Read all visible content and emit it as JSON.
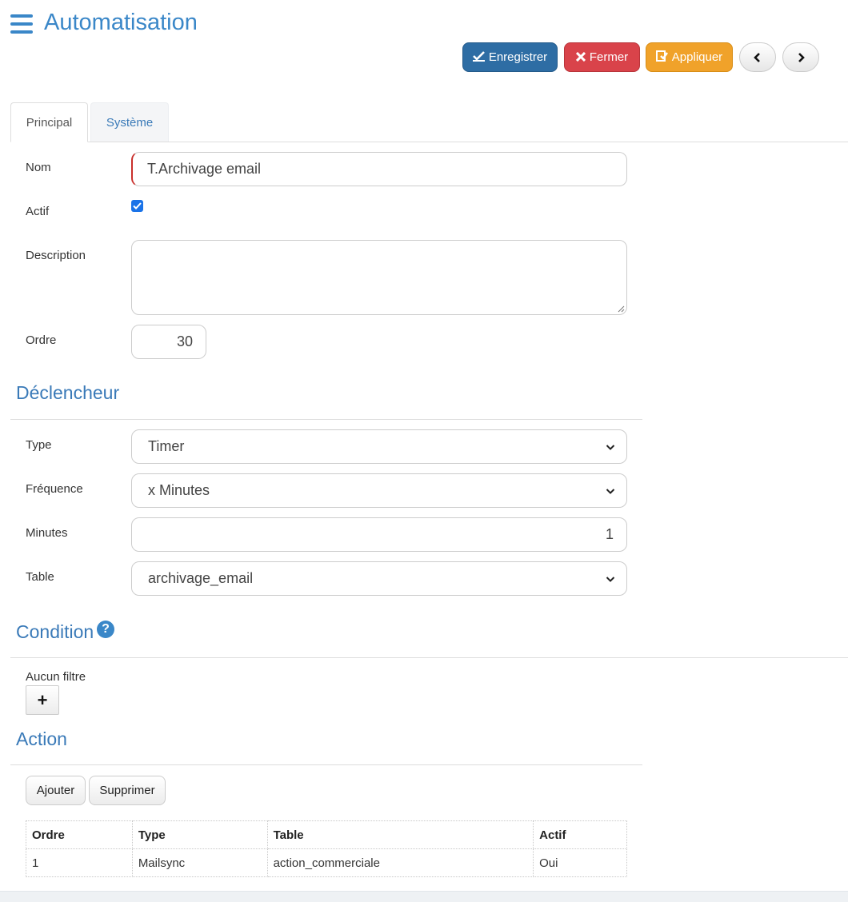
{
  "header": {
    "title": "Automatisation"
  },
  "toolbar": {
    "save_label": "Enregistrer",
    "close_label": "Fermer",
    "apply_label": "Appliquer",
    "prev_icon": "chevron-left-icon",
    "next_icon": "chevron-right-icon"
  },
  "tabs": [
    {
      "label": "Principal",
      "active": true
    },
    {
      "label": "Système",
      "active": false
    }
  ],
  "form": {
    "nom_label": "Nom",
    "nom_value": "T.Archivage email",
    "actif_label": "Actif",
    "actif_checked": true,
    "description_label": "Description",
    "description_value": "",
    "ordre_label": "Ordre",
    "ordre_value": "30"
  },
  "trigger": {
    "title": "Déclencheur",
    "type_label": "Type",
    "type_value": "Timer",
    "frequence_label": "Fréquence",
    "frequence_value": "x Minutes",
    "minutes_label": "Minutes",
    "minutes_value": "1",
    "table_label": "Table",
    "table_value": "archivage_email"
  },
  "condition": {
    "title": "Condition",
    "no_filter_label": "Aucun filtre",
    "add_filter_symbol": "+"
  },
  "action": {
    "title": "Action",
    "add_label": "Ajouter",
    "delete_label": "Supprimer",
    "columns": [
      "Ordre",
      "Type",
      "Table",
      "Actif"
    ],
    "rows": [
      [
        "1",
        "Mailsync",
        "action_commerciale",
        "Oui"
      ]
    ]
  },
  "colors": {
    "accent": "#3a87c8",
    "save": "#2e6da4",
    "close": "#d9434a",
    "apply": "#f0a22a"
  }
}
